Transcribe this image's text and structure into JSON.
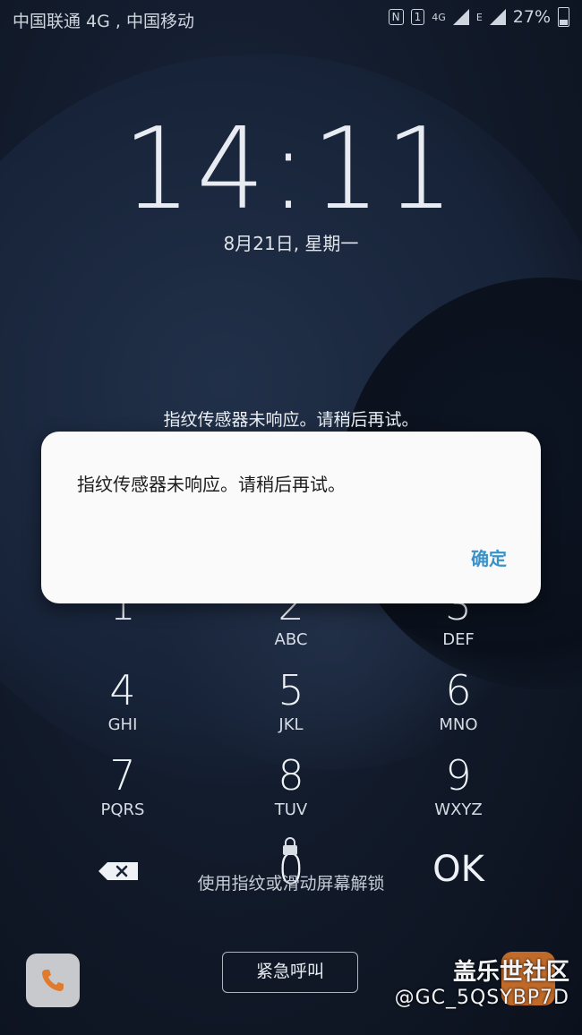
{
  "status_bar": {
    "carrier": "中国联通 4G , 中国移动",
    "nfc": "N",
    "sim": "1",
    "network1": "4G",
    "network2": "E",
    "battery_percent": "27%"
  },
  "lockscreen": {
    "time": "14:11",
    "date": "8月21日, 星期一",
    "hint_message": "指纹传感器未响应。请稍后再试。",
    "unlock_hint": "使用指纹或滑动屏幕解锁"
  },
  "dialog": {
    "message": "指纹传感器未响应。请稍后再试。",
    "confirm_label": "确定"
  },
  "keypad": {
    "keys": [
      {
        "num": "1",
        "letters": ""
      },
      {
        "num": "2",
        "letters": "ABC"
      },
      {
        "num": "3",
        "letters": "DEF"
      },
      {
        "num": "4",
        "letters": "GHI"
      },
      {
        "num": "5",
        "letters": "JKL"
      },
      {
        "num": "6",
        "letters": "MNO"
      },
      {
        "num": "7",
        "letters": "PQRS"
      },
      {
        "num": "8",
        "letters": "TUV"
      },
      {
        "num": "9",
        "letters": "WXYZ"
      }
    ],
    "zero": "0",
    "ok": "OK"
  },
  "bottom": {
    "emergency_label": "紧急呼叫"
  },
  "watermark": {
    "site": "盖乐世社区",
    "user": "@GC_5QSYBP7D"
  },
  "colors": {
    "accent": "#3a92c9",
    "background": "#0f1726"
  }
}
